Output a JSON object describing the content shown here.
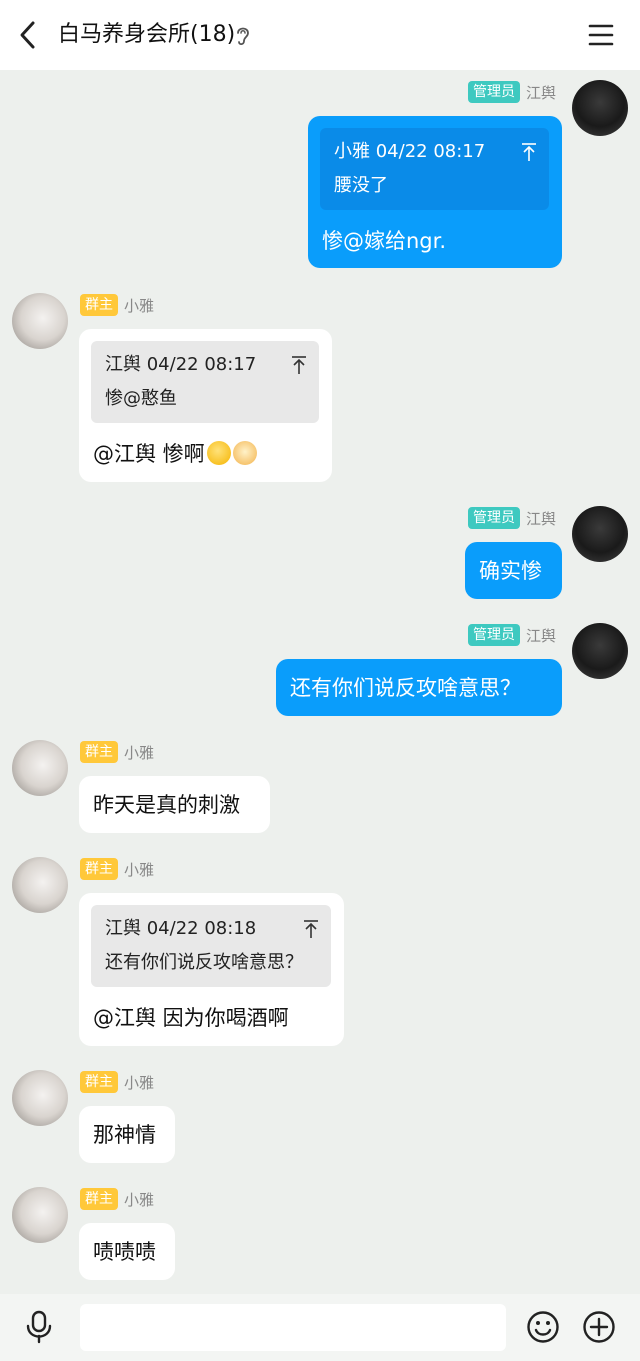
{
  "header": {
    "title": "白马养身会所(18)"
  },
  "messages": [
    {
      "user": "江舆",
      "badge": "管理员",
      "quote_head": "小雅 04/22 08:17",
      "quote_body": "腰没了",
      "text": "惨@嫁给ngr."
    },
    {
      "user": "小雅",
      "badge": "群主",
      "quote_head": "江舆 04/22 08:17",
      "quote_body": "惨@憨鱼",
      "text": "@江舆 惨啊"
    },
    {
      "user": "江舆",
      "badge": "管理员",
      "text": "确实惨"
    },
    {
      "user": "江舆",
      "badge": "管理员",
      "text": "还有你们说反攻啥意思？"
    },
    {
      "user": "小雅",
      "badge": "群主",
      "text": "昨天是真的刺激"
    },
    {
      "user": "小雅",
      "badge": "群主",
      "quote_head": "江舆 04/22 08:18",
      "quote_body": "还有你们说反攻啥意思？",
      "text": "@江舆 因为你喝酒啊"
    },
    {
      "user": "小雅",
      "badge": "群主",
      "text": "那神情"
    },
    {
      "user": "小雅",
      "badge": "群主",
      "text": "啧啧啧"
    }
  ],
  "composer": {
    "value": "",
    "placeholder": ""
  },
  "colors": {
    "out_bubble": "#0a9dfb",
    "admin_badge": "#3ec9c0",
    "owner_badge": "#ffc83a",
    "background": "#edf0ed"
  },
  "icons": [
    "back-arrow-icon",
    "ear-icon",
    "menu-icon",
    "reply-jump-icon",
    "microphone-icon",
    "emoji-icon",
    "plus-icon"
  ]
}
